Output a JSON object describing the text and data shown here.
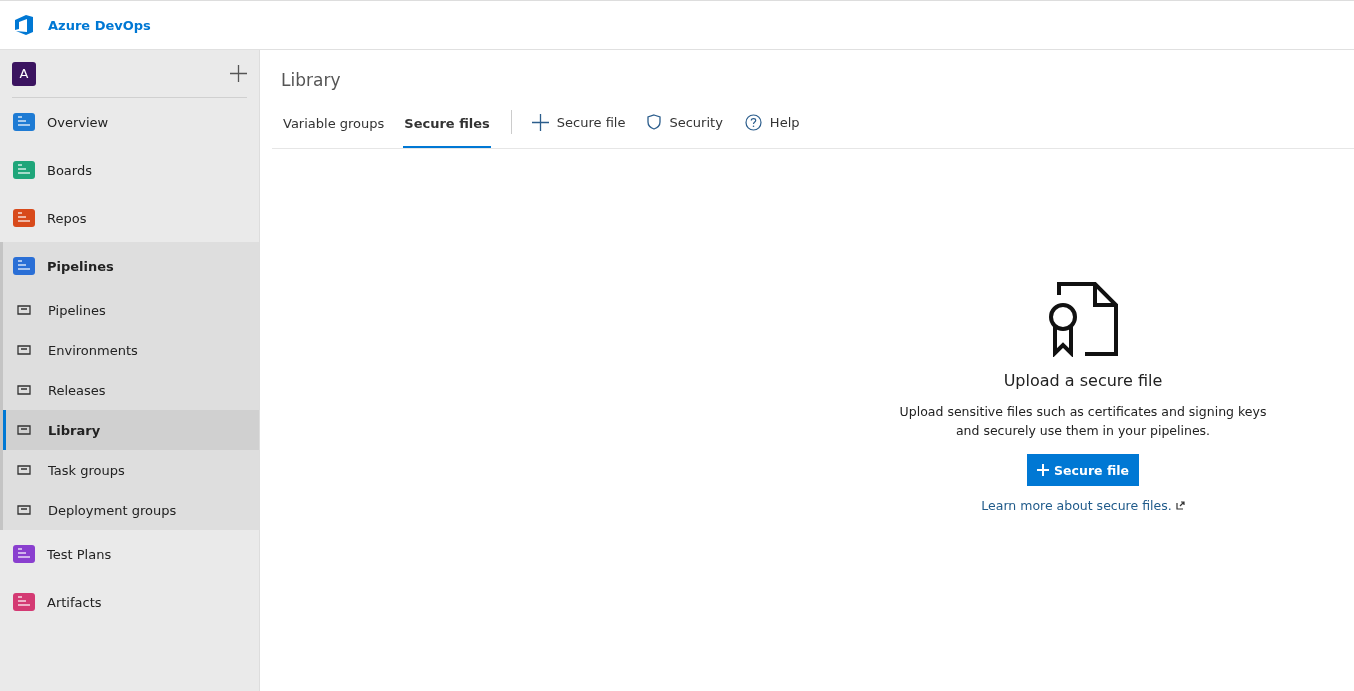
{
  "header": {
    "product": "Azure DevOps"
  },
  "sidebar": {
    "project_initial": "A",
    "items": [
      {
        "label": "Overview",
        "selected": false
      },
      {
        "label": "Boards",
        "selected": false
      },
      {
        "label": "Repos",
        "selected": false
      },
      {
        "label": "Pipelines",
        "selected": false,
        "expanded": true,
        "children": [
          {
            "label": "Pipelines",
            "selected": false
          },
          {
            "label": "Environments",
            "selected": false
          },
          {
            "label": "Releases",
            "selected": false
          },
          {
            "label": "Library",
            "selected": true
          },
          {
            "label": "Task groups",
            "selected": false
          },
          {
            "label": "Deployment groups",
            "selected": false
          }
        ]
      },
      {
        "label": "Test Plans",
        "selected": false
      },
      {
        "label": "Artifacts",
        "selected": false
      }
    ]
  },
  "page": {
    "title": "Library",
    "tabs": [
      {
        "label": "Variable groups",
        "selected": false
      },
      {
        "label": "Secure files",
        "selected": true
      }
    ],
    "actions": [
      {
        "label": "Secure file",
        "kind": "add"
      },
      {
        "label": "Security",
        "kind": "shield"
      },
      {
        "label": "Help",
        "kind": "help"
      }
    ]
  },
  "empty_state": {
    "heading": "Upload a secure file",
    "text": "Upload sensitive files such as certificates and signing keys and securely use them in your pipelines.",
    "button": "Secure file",
    "link": "Learn more about secure files."
  }
}
